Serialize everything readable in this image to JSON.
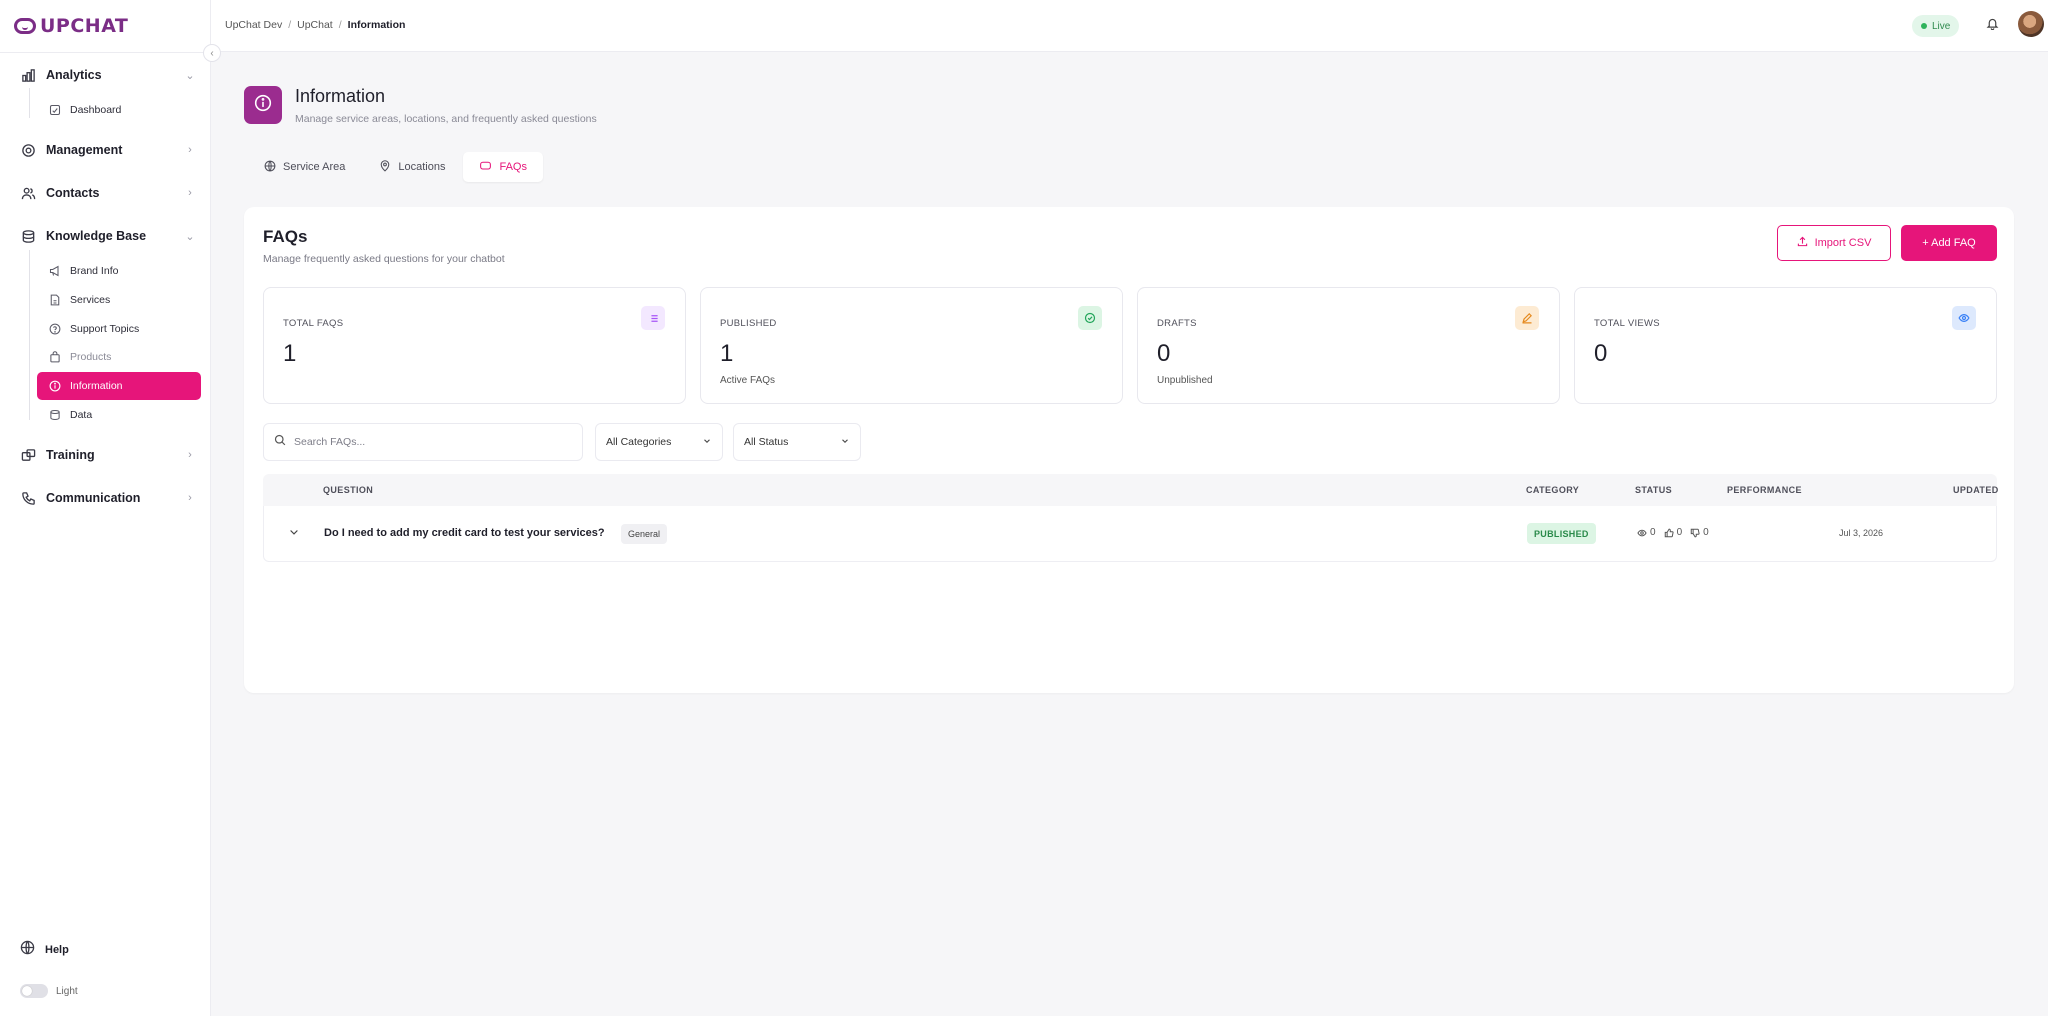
{
  "brand": {
    "name": "UPCHAT",
    "color": "#7b2d86",
    "accent": "#e6157a"
  },
  "sidebar": {
    "groups": [
      {
        "label": "Analytics",
        "icon": "bar-chart-icon",
        "expanded": true,
        "children": [
          {
            "label": "Dashboard",
            "icon": "dashboard-icon"
          }
        ]
      },
      {
        "label": "Management",
        "icon": "gear-icon",
        "expanded": false
      },
      {
        "label": "Contacts",
        "icon": "users-icon",
        "expanded": false
      },
      {
        "label": "Knowledge Base",
        "icon": "database-icon",
        "expanded": true,
        "children": [
          {
            "label": "Brand Info",
            "icon": "megaphone-icon"
          },
          {
            "label": "Services",
            "icon": "document-icon"
          },
          {
            "label": "Support Topics",
            "icon": "help-circle-icon"
          },
          {
            "label": "Products",
            "icon": "bag-icon"
          },
          {
            "label": "Information",
            "icon": "info-icon",
            "active": true
          },
          {
            "label": "Data",
            "icon": "database-icon"
          }
        ]
      },
      {
        "label": "Training",
        "icon": "training-icon",
        "expanded": false
      },
      {
        "label": "Communication",
        "icon": "phone-icon",
        "expanded": false
      }
    ],
    "help_label": "Help",
    "theme_label": "Light"
  },
  "header": {
    "breadcrumb": [
      "UpChat Dev",
      "UpChat",
      "Information"
    ],
    "live_label": "Live"
  },
  "page": {
    "title": "Information",
    "subtitle": "Manage service areas, locations, and frequently asked questions",
    "tabs": [
      {
        "label": "Service Area",
        "icon": "globe-icon"
      },
      {
        "label": "Locations",
        "icon": "map-pin-icon"
      },
      {
        "label": "FAQs",
        "icon": "chat-icon",
        "active": true
      }
    ]
  },
  "faqs": {
    "title": "FAQs",
    "subtitle": "Manage frequently asked questions for your chatbot",
    "import_label": "Import CSV",
    "add_label": "+ Add FAQ",
    "stats": [
      {
        "label": "TOTAL FAQS",
        "value": "1",
        "sub": "",
        "icon": "list-icon",
        "color": "#a855f7",
        "bg": "#f3e8ff"
      },
      {
        "label": "PUBLISHED",
        "value": "1",
        "sub": "Active FAQs",
        "icon": "check-circle-icon",
        "color": "#22a55a",
        "bg": "#dcf5e4"
      },
      {
        "label": "DRAFTS",
        "value": "0",
        "sub": "Unpublished",
        "icon": "pencil-icon",
        "color": "#e58a1f",
        "bg": "#fdebd3"
      },
      {
        "label": "TOTAL VIEWS",
        "value": "0",
        "sub": "",
        "icon": "eye-icon",
        "color": "#3b82f6",
        "bg": "#dde9fd"
      }
    ],
    "search_placeholder": "Search FAQs...",
    "category_filter": "All Categories",
    "status_filter": "All Status",
    "columns": {
      "question": "QUESTION",
      "category": "CATEGORY",
      "status": "STATUS",
      "performance": "PERFORMANCE",
      "updated": "UPDATED"
    },
    "rows": [
      {
        "question": "Do I need to add my credit card to test your services?",
        "category": "General",
        "status": "PUBLISHED",
        "views": "0",
        "likes": "0",
        "dislikes": "0",
        "updated": "Jul 3, 2026"
      }
    ]
  }
}
